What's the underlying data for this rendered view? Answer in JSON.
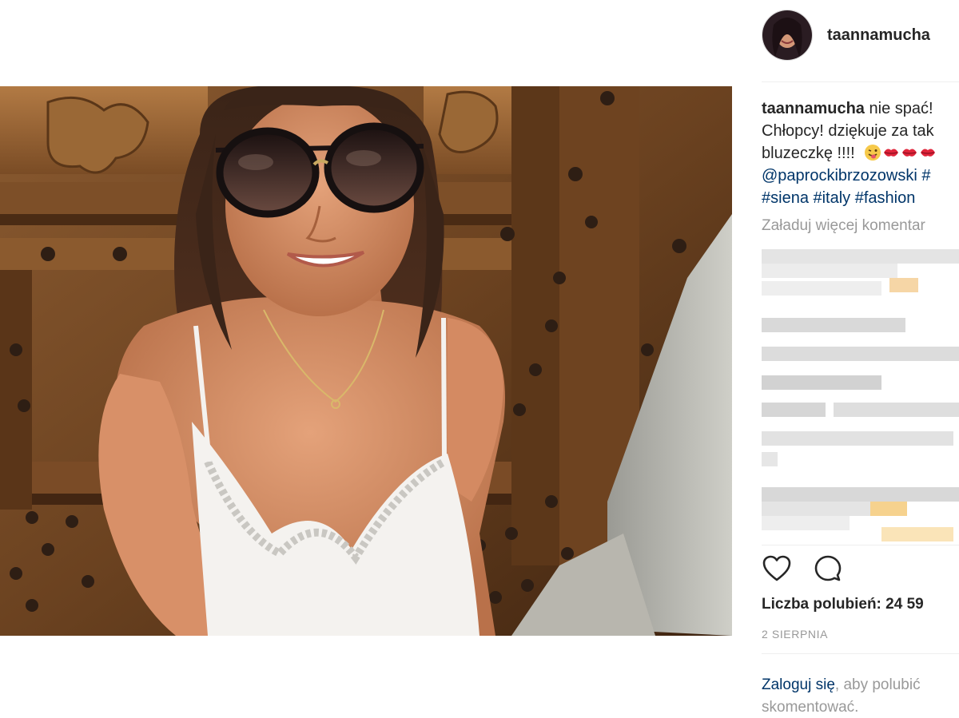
{
  "post": {
    "username": "taannamucha",
    "caption": {
      "username": "taannamucha",
      "line1": "nie spać!",
      "line2": "Chłopcy! dziękuje za tak",
      "line3": "bluzeczkę !!!!",
      "mention": "@paprockibrzozowski #",
      "tags": "#siena #italy #fashion"
    },
    "load_more": "Załaduj więcej komentar",
    "likes": "Liczba polubień: 24 59",
    "date": "2 SIERPNIA",
    "login": {
      "link": "Zaloguj się",
      "rest": ", aby polubić",
      "line2": "skomentować."
    }
  },
  "icons": {
    "like": "heart-icon",
    "comment": "comment-icon",
    "emoji": [
      "winking-face-tongue-icon",
      "kiss-mark-icon",
      "kiss-mark-icon",
      "kiss-mark-icon"
    ]
  },
  "colors": {
    "text": "#262626",
    "link": "#003569",
    "muted": "#999999",
    "divider": "#efefef"
  }
}
